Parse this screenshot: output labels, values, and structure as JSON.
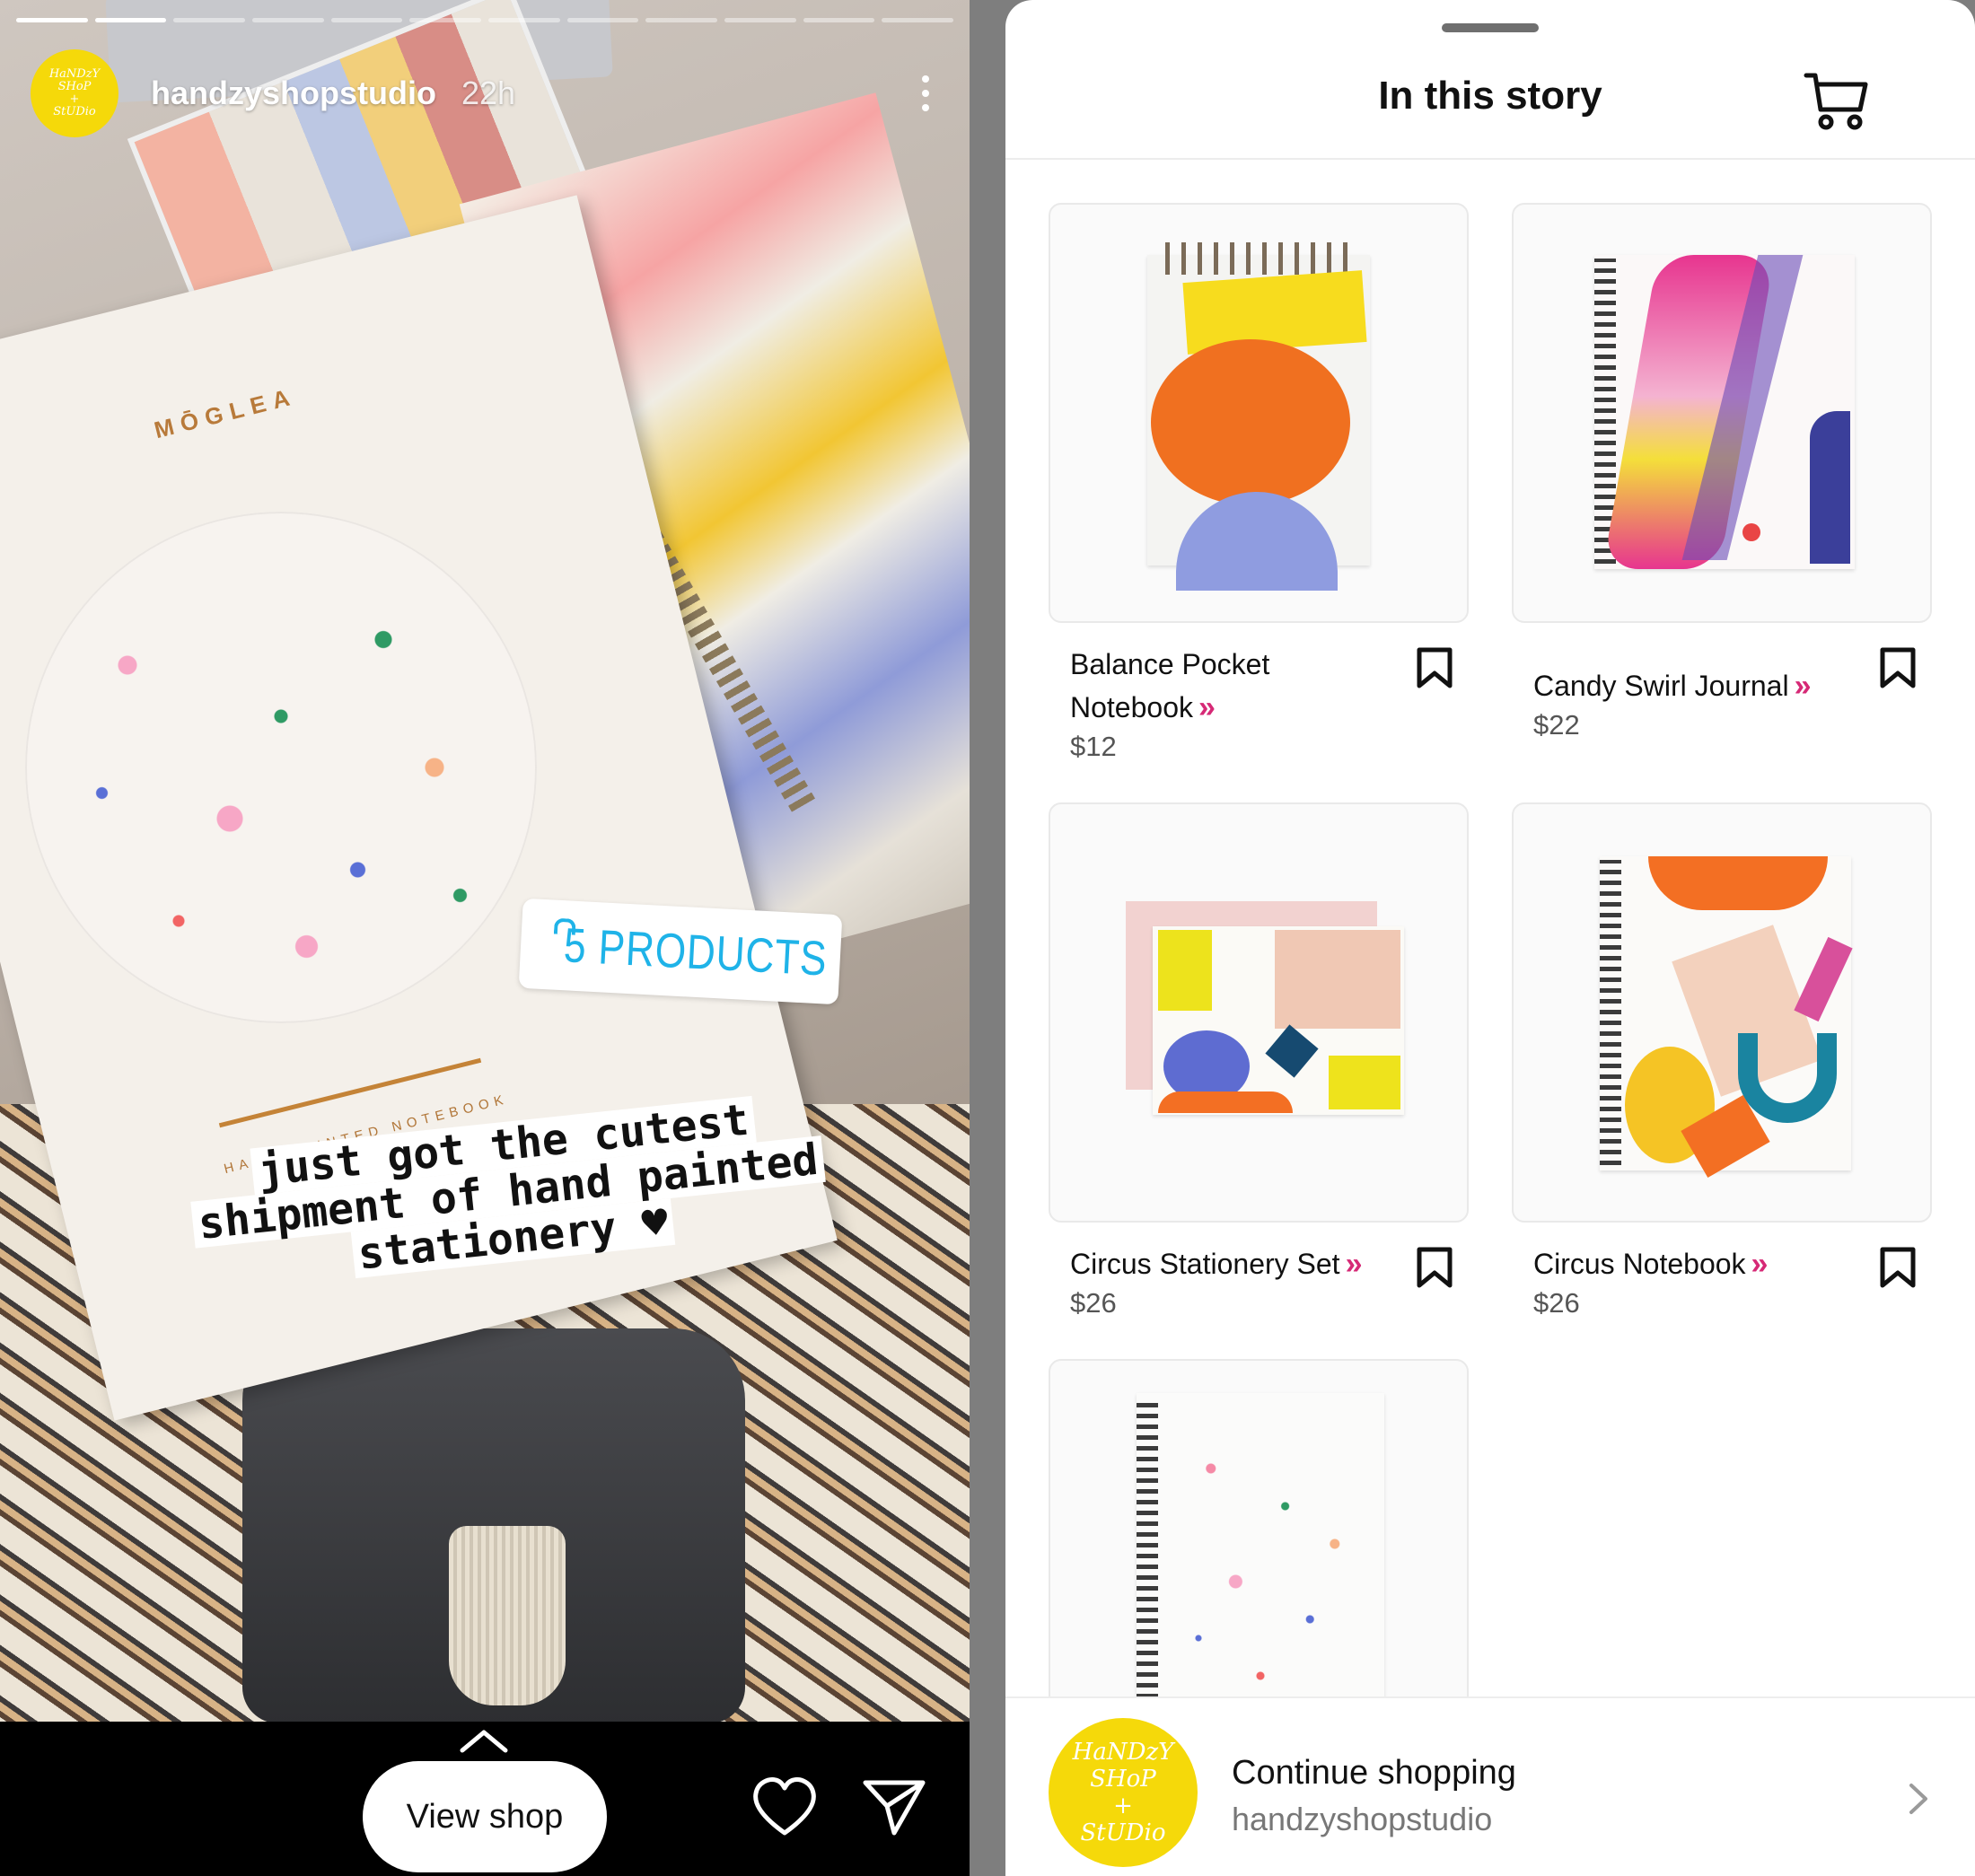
{
  "story": {
    "username": "handzyshopstudio",
    "time_ago": "22h",
    "avatar_text": "HaNDzY\nSHoP\n+\nStUDio",
    "progress_segments_total": 12,
    "progress_segments_done": 2,
    "photo": {
      "brand_text": "MŌGLEA",
      "notebook_text": "HAND PAINTED NOTEBOOK"
    },
    "products_sticker": {
      "label": "5 PRODUCTS",
      "icon": "shopping-bag-icon"
    },
    "caption_lines": [
      "just got the cutest",
      "shipment of hand painted",
      "stationery ♥"
    ],
    "view_shop_label": "View shop",
    "colors": {
      "sticker_blue": "#1fb3e8",
      "avatar_yellow": "#f5d90a"
    }
  },
  "sheet": {
    "title": "In this story",
    "cart_icon": "shopping-cart-icon",
    "link_chevrons": "»",
    "products": [
      {
        "name": "Balance Pocket Notebook",
        "price": "$12"
      },
      {
        "name": "Candy Swirl Journal",
        "price": "$22"
      },
      {
        "name": "Circus Stationery Set",
        "price": "$26"
      },
      {
        "name": "Circus Notebook",
        "price": "$26"
      },
      {
        "name": "",
        "price": ""
      }
    ],
    "continue": {
      "title": "Continue shopping",
      "username": "handzyshopstudio",
      "avatar_text": "HaNDzY\nSHoP\n+\nStUDio"
    },
    "colors": {
      "accent_chevron": "#d62976"
    }
  }
}
